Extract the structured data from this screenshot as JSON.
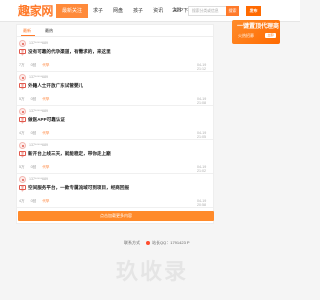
{
  "header": {
    "logo": "趣家网",
    "nav": [
      "最新关注",
      "求子",
      "网盘",
      "孩子",
      "资讯",
      "APP下载"
    ],
    "city": "全国",
    "search_placeholder": "搜索分类或信息",
    "search_label": "搜索",
    "publish_label": "发布"
  },
  "banner": {
    "title": "一键置顶代理商",
    "subtitle": "火热招募",
    "cta": "立即"
  },
  "tabs": [
    "最新",
    "最热"
  ],
  "items": [
    {
      "user": "137*****689",
      "category": "求子",
      "title": "没有可靠的代孕渠道，有需求的，来这里",
      "views": "7万",
      "comments": "0回",
      "tag": "代孕",
      "date": "04-19 21:12"
    },
    {
      "user": "137*****689",
      "category": "求子",
      "title": "外籍人士开放广东试管婴儿",
      "views": "5万",
      "comments": "0回",
      "tag": "代孕",
      "date": "04-19 21:08"
    },
    {
      "user": "137*****689",
      "category": "求子",
      "title": "做医APP可靠认证",
      "views": "4万",
      "comments": "0回",
      "tag": "代孕",
      "date": "04-19 21:05"
    },
    {
      "user": "137*****689",
      "category": "求子",
      "title": "新开台上线三天，就能稳定，带你走上巅",
      "views": "5万",
      "comments": "0回",
      "tag": "代孕",
      "date": "04-19 21:02"
    },
    {
      "user": "137*****689",
      "category": "求子",
      "title": "空间服务平台，一款专属流域可到项目，经商回报",
      "views": "4万",
      "comments": "0回",
      "tag": "代孕",
      "date": "04-19 20:58"
    }
  ],
  "more_label": "点击加载更多内容",
  "footer": {
    "link1": "联系方式",
    "link2": "站长QQ：1791423 P"
  },
  "watermark": "玖收录"
}
